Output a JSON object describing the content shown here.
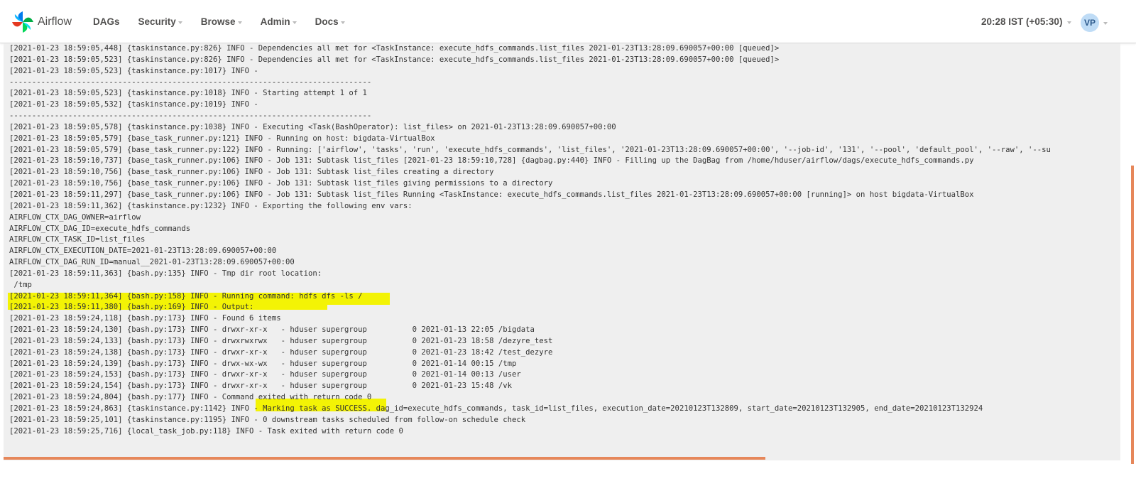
{
  "app": {
    "brand": "Airflow",
    "nav": [
      {
        "label": "DAGs",
        "has_caret": false
      },
      {
        "label": "Security",
        "has_caret": true
      },
      {
        "label": "Browse",
        "has_caret": true
      },
      {
        "label": "Admin",
        "has_caret": true
      },
      {
        "label": "Docs",
        "has_caret": true
      }
    ],
    "clock": "20:28 IST (+05:30)",
    "user_initials": "VP"
  },
  "colors": {
    "accent": "#e6875a",
    "highlight": "#f3f305",
    "log_background": "#efefef",
    "avatar_bg": "#bfdcf6"
  },
  "highlights": [
    "Running command",
    "Marking task as SUCCESS"
  ],
  "log": {
    "lines": [
      "[2021-01-23 18:59:05,448] {taskinstance.py:826} INFO - Dependencies all met for <TaskInstance: execute_hdfs_commands.list_files 2021-01-23T13:28:09.690057+00:00 [queued]>",
      "[2021-01-23 18:59:05,523] {taskinstance.py:826} INFO - Dependencies all met for <TaskInstance: execute_hdfs_commands.list_files 2021-01-23T13:28:09.690057+00:00 [queued]>",
      "[2021-01-23 18:59:05,523] {taskinstance.py:1017} INFO -",
      "--------------------------------------------------------------------------------",
      "[2021-01-23 18:59:05,523] {taskinstance.py:1018} INFO - Starting attempt 1 of 1",
      "[2021-01-23 18:59:05,532] {taskinstance.py:1019} INFO -",
      "--------------------------------------------------------------------------------",
      "[2021-01-23 18:59:05,578] {taskinstance.py:1038} INFO - Executing <Task(BashOperator): list_files> on 2021-01-23T13:28:09.690057+00:00",
      "[2021-01-23 18:59:05,579] {base_task_runner.py:121} INFO - Running on host: bigdata-VirtualBox",
      "[2021-01-23 18:59:05,579] {base_task_runner.py:122} INFO - Running: ['airflow', 'tasks', 'run', 'execute_hdfs_commands', 'list_files', '2021-01-23T13:28:09.690057+00:00', '--job-id', '131', '--pool', 'default_pool', '--raw', '--su",
      "[2021-01-23 18:59:10,737] {base_task_runner.py:106} INFO - Job 131: Subtask list_files [2021-01-23 18:59:10,728] {dagbag.py:440} INFO - Filling up the DagBag from /home/hduser/airflow/dags/execute_hdfs_commands.py",
      "[2021-01-23 18:59:10,756] {base_task_runner.py:106} INFO - Job 131: Subtask list_files creating a directory",
      "[2021-01-23 18:59:10,756] {base_task_runner.py:106} INFO - Job 131: Subtask list_files giving permissions to a directory",
      "[2021-01-23 18:59:11,297] {base_task_runner.py:106} INFO - Job 131: Subtask list_files Running <TaskInstance: execute_hdfs_commands.list_files 2021-01-23T13:28:09.690057+00:00 [running]> on host bigdata-VirtualBox",
      "[2021-01-23 18:59:11,362] {taskinstance.py:1232} INFO - Exporting the following env vars:",
      "AIRFLOW_CTX_DAG_OWNER=airflow",
      "AIRFLOW_CTX_DAG_ID=execute_hdfs_commands",
      "AIRFLOW_CTX_TASK_ID=list_files",
      "AIRFLOW_CTX_EXECUTION_DATE=2021-01-23T13:28:09.690057+00:00",
      "AIRFLOW_CTX_DAG_RUN_ID=manual__2021-01-23T13:28:09.690057+00:00",
      "[2021-01-23 18:59:11,363] {bash.py:135} INFO - Tmp dir root location:",
      " /tmp",
      "[2021-01-23 18:59:11,364] {bash.py:158} INFO - Running command: hdfs dfs -ls /",
      "[2021-01-23 18:59:11,380] {bash.py:169} INFO - Output:",
      "[2021-01-23 18:59:24,118] {bash.py:173} INFO - Found 6 items",
      "[2021-01-23 18:59:24,130] {bash.py:173} INFO - drwxr-xr-x   - hduser supergroup          0 2021-01-13 22:05 /bigdata",
      "[2021-01-23 18:59:24,133] {bash.py:173} INFO - drwxrwxrwx   - hduser supergroup          0 2021-01-23 18:58 /dezyre_test",
      "[2021-01-23 18:59:24,138] {bash.py:173} INFO - drwxr-xr-x   - hduser supergroup          0 2021-01-23 18:42 /test_dezyre",
      "[2021-01-23 18:59:24,139] {bash.py:173} INFO - drwx-wx-wx   - hduser supergroup          0 2021-01-14 00:15 /tmp",
      "[2021-01-23 18:59:24,153] {bash.py:173} INFO - drwxr-xr-x   - hduser supergroup          0 2021-01-14 00:13 /user",
      "[2021-01-23 18:59:24,154] {bash.py:173} INFO - drwxr-xr-x   - hduser supergroup          0 2021-01-23 15:48 /vk",
      "[2021-01-23 18:59:24,804] {bash.py:177} INFO - Command exited with return code 0",
      "[2021-01-23 18:59:24,863] {taskinstance.py:1142} INFO - Marking task as SUCCESS. dag_id=execute_hdfs_commands, task_id=list_files, execution_date=20210123T132809, start_date=20210123T132905, end_date=20210123T132924",
      "[2021-01-23 18:59:25,101] {taskinstance.py:1195} INFO - 0 downstream tasks scheduled from follow-on schedule check",
      "[2021-01-23 18:59:25,716] {local_task_job.py:118} INFO - Task exited with return code 0"
    ]
  }
}
